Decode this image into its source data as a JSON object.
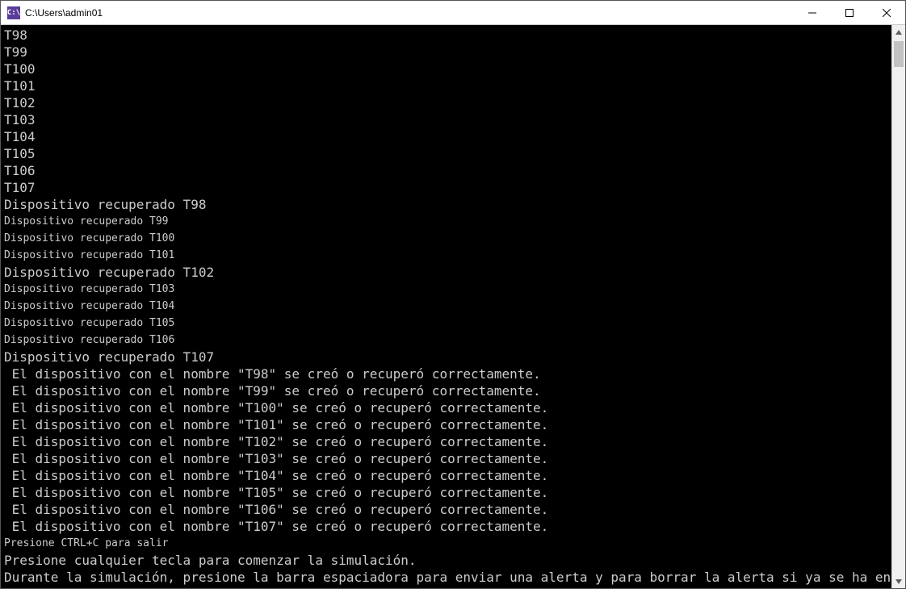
{
  "window": {
    "title": "C:\\Users\\admin01",
    "icon_text": "C:\\"
  },
  "console": {
    "lines": [
      {
        "cls": "big",
        "text": "T98"
      },
      {
        "cls": "big",
        "text": "T99"
      },
      {
        "cls": "big",
        "text": "T100"
      },
      {
        "cls": "big",
        "text": "T101"
      },
      {
        "cls": "big",
        "text": "T102"
      },
      {
        "cls": "big",
        "text": "T103"
      },
      {
        "cls": "big",
        "text": "T104"
      },
      {
        "cls": "big",
        "text": "T105"
      },
      {
        "cls": "big",
        "text": "T106"
      },
      {
        "cls": "big",
        "text": "T107"
      },
      {
        "cls": "big",
        "text": "Dispositivo recuperado T98"
      },
      {
        "cls": "sml",
        "text": "Dispositivo recuperado T99"
      },
      {
        "cls": "sml",
        "text": "Dispositivo recuperado T100"
      },
      {
        "cls": "sml",
        "text": "Dispositivo recuperado T101"
      },
      {
        "cls": "big",
        "text": "Dispositivo recuperado T102"
      },
      {
        "cls": "sml",
        "text": "Dispositivo recuperado T103"
      },
      {
        "cls": "sml",
        "text": "Dispositivo recuperado T104"
      },
      {
        "cls": "sml",
        "text": "Dispositivo recuperado T105"
      },
      {
        "cls": "sml",
        "text": "Dispositivo recuperado T106"
      },
      {
        "cls": "big",
        "text": "Dispositivo recuperado T107"
      },
      {
        "cls": "big",
        "text": " El dispositivo con el nombre \"T98\" se creó o recuperó correctamente."
      },
      {
        "cls": "big",
        "text": " El dispositivo con el nombre \"T99\" se creó o recuperó correctamente."
      },
      {
        "cls": "big",
        "text": " El dispositivo con el nombre \"T100\" se creó o recuperó correctamente."
      },
      {
        "cls": "big",
        "text": " El dispositivo con el nombre \"T101\" se creó o recuperó correctamente."
      },
      {
        "cls": "big",
        "text": " El dispositivo con el nombre \"T102\" se creó o recuperó correctamente."
      },
      {
        "cls": "big",
        "text": " El dispositivo con el nombre \"T103\" se creó o recuperó correctamente."
      },
      {
        "cls": "big",
        "text": " El dispositivo con el nombre \"T104\" se creó o recuperó correctamente."
      },
      {
        "cls": "big",
        "text": " El dispositivo con el nombre \"T105\" se creó o recuperó correctamente."
      },
      {
        "cls": "big",
        "text": " El dispositivo con el nombre \"T106\" se creó o recuperó correctamente."
      },
      {
        "cls": "big",
        "text": " El dispositivo con el nombre \"T107\" se creó o recuperó correctamente."
      },
      {
        "cls": "sml",
        "text": "Presione CTRL+C para salir"
      },
      {
        "cls": "big",
        "text": "Presione cualquier tecla para comenzar la simulación."
      },
      {
        "cls": "big",
        "text": "Durante la simulación, presione la barra espaciadora para enviar una alerta y para borrar la alerta si ya se ha enviado una)."
      }
    ]
  }
}
